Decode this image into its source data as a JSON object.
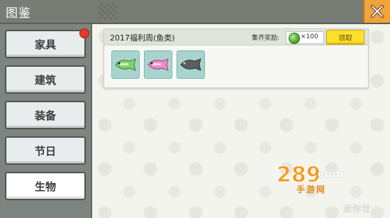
{
  "window": {
    "title": "图鉴"
  },
  "sidebar": {
    "items": [
      {
        "label": "家具",
        "active": false,
        "has_badge": true
      },
      {
        "label": "建筑",
        "active": false,
        "has_badge": false
      },
      {
        "label": "装备",
        "active": false,
        "has_badge": false
      },
      {
        "label": "节日",
        "active": false,
        "has_badge": false
      },
      {
        "label": "生物",
        "active": true,
        "has_badge": false
      }
    ]
  },
  "collection": {
    "title": "2017福利周(鱼类)",
    "reward_label": "集齐奖励:",
    "reward_icon": "green-gem-icon",
    "reward_amount": "×100",
    "claim_label": "领取",
    "items": [
      {
        "name": "green-fish-icon",
        "color": "#7fd46a"
      },
      {
        "name": "pink-fish-icon",
        "color": "#f08ac8"
      },
      {
        "name": "gray-fish-icon",
        "color": "#5a5e60"
      }
    ]
  },
  "watermark": {
    "brand": "289com",
    "subtitle": "手游网",
    "corner": "迷你世"
  },
  "colors": {
    "titlebar": "#777d75",
    "close_button": "#f0a43a",
    "claim_button": "#ffe02a",
    "item_bg": "#a8d4cf",
    "badge": "#e23a2a"
  }
}
